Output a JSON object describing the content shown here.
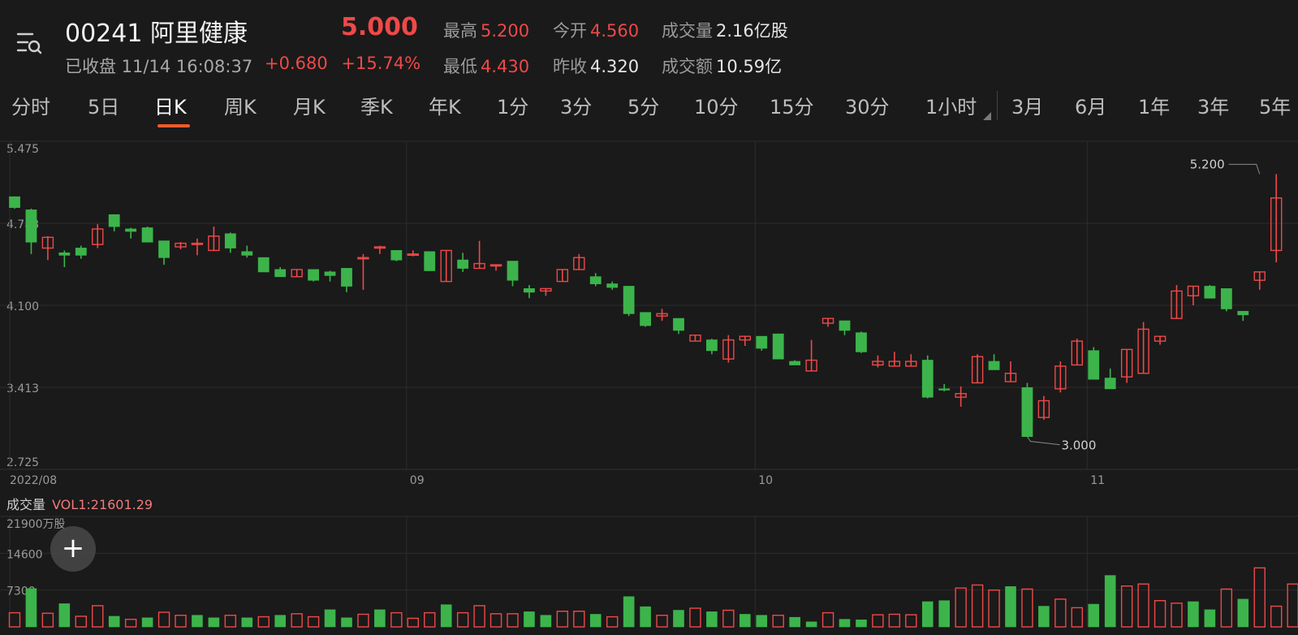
{
  "header": {
    "menu_icon": "menu-search-icon",
    "title": "00241 阿里健康",
    "price": "5.000",
    "status": "已收盘 11/14 16:08:37",
    "change_abs": "+0.680",
    "change_pct": "+15.74%",
    "stats": {
      "high_label": "最高",
      "high": "5.200",
      "open_label": "今开",
      "open": "4.560",
      "volume_label": "成交量",
      "volume": "2.16亿股",
      "low_label": "最低",
      "low": "4.430",
      "prev_close_label": "昨收",
      "prev_close": "4.320",
      "turnover_label": "成交额",
      "turnover": "10.59亿"
    },
    "colors": {
      "up": "#f04848",
      "down": "#3cb44b",
      "accent": "#f05a28"
    }
  },
  "tabs": [
    "分时",
    "5日",
    "日K",
    "周K",
    "月K",
    "季K",
    "年K",
    "1分",
    "3分",
    "5分",
    "10分",
    "15分",
    "30分",
    "1小时",
    "3月",
    "6月",
    "1年",
    "3年",
    "5年"
  ],
  "active_tab": "日K",
  "volume_panel": {
    "title": "成交量",
    "indicator": "VOL1:21601.29",
    "unit_label": "21900万股",
    "ticks": [
      "14600",
      "7300"
    ]
  },
  "plus_icon": "plus-icon",
  "chart_data": [
    {
      "type": "candlestick",
      "title": "",
      "y_ticks": [
        "5.475",
        "4.788",
        "4.100",
        "3.413",
        "2.725"
      ],
      "ylim": [
        2.725,
        5.475
      ],
      "x_labels": [
        "2022/08",
        "09",
        "10",
        "11"
      ],
      "annotations": [
        {
          "text": "5.200",
          "x_index": 75,
          "value": 5.2
        },
        {
          "text": "3.000",
          "x_index": 61,
          "value": 3.0
        }
      ],
      "candles": [
        [
          5.01,
          5.01,
          4.91,
          4.92
        ],
        [
          4.9,
          4.91,
          4.53,
          4.63
        ],
        [
          4.58,
          4.68,
          4.48,
          4.67
        ],
        [
          4.54,
          4.56,
          4.42,
          4.52
        ],
        [
          4.58,
          4.6,
          4.49,
          4.52
        ],
        [
          4.61,
          4.78,
          4.58,
          4.74
        ],
        [
          4.86,
          4.86,
          4.72,
          4.76
        ],
        [
          4.74,
          4.75,
          4.66,
          4.72
        ],
        [
          4.75,
          4.76,
          4.63,
          4.63
        ],
        [
          4.64,
          4.64,
          4.44,
          4.5
        ],
        [
          4.59,
          4.63,
          4.57,
          4.62
        ],
        [
          4.61,
          4.66,
          4.52,
          4.62
        ],
        [
          4.56,
          4.76,
          4.56,
          4.68
        ],
        [
          4.7,
          4.71,
          4.54,
          4.58
        ],
        [
          4.55,
          4.6,
          4.5,
          4.52
        ],
        [
          4.5,
          4.5,
          4.38,
          4.38
        ],
        [
          4.4,
          4.42,
          4.34,
          4.34
        ],
        [
          4.34,
          4.4,
          4.34,
          4.4
        ],
        [
          4.4,
          4.4,
          4.3,
          4.31
        ],
        [
          4.38,
          4.39,
          4.3,
          4.35
        ],
        [
          4.41,
          4.41,
          4.21,
          4.26
        ],
        [
          4.5,
          4.53,
          4.23,
          4.5
        ],
        [
          4.59,
          4.6,
          4.53,
          4.59
        ],
        [
          4.56,
          4.56,
          4.47,
          4.48
        ],
        [
          4.53,
          4.56,
          4.51,
          4.53
        ],
        [
          4.55,
          4.55,
          4.39,
          4.39
        ],
        [
          4.3,
          4.56,
          4.3,
          4.56
        ],
        [
          4.48,
          4.54,
          4.38,
          4.41
        ],
        [
          4.41,
          4.64,
          4.41,
          4.45
        ],
        [
          4.44,
          4.44,
          4.39,
          4.44
        ],
        [
          4.47,
          4.47,
          4.26,
          4.31
        ],
        [
          4.24,
          4.27,
          4.16,
          4.21
        ],
        [
          4.22,
          4.24,
          4.18,
          4.24
        ],
        [
          4.3,
          4.4,
          4.3,
          4.4
        ],
        [
          4.4,
          4.53,
          4.4,
          4.5
        ],
        [
          4.34,
          4.37,
          4.26,
          4.28
        ],
        [
          4.28,
          4.3,
          4.23,
          4.25
        ],
        [
          4.26,
          4.26,
          4.01,
          4.03
        ],
        [
          4.04,
          4.04,
          3.92,
          3.93
        ],
        [
          4.01,
          4.07,
          3.97,
          4.03
        ],
        [
          3.99,
          3.99,
          3.86,
          3.89
        ],
        [
          3.8,
          3.85,
          3.8,
          3.85
        ],
        [
          3.81,
          3.82,
          3.69,
          3.72
        ],
        [
          3.65,
          3.85,
          3.62,
          3.81
        ],
        [
          3.81,
          3.84,
          3.76,
          3.84
        ],
        [
          3.84,
          3.84,
          3.72,
          3.74
        ],
        [
          3.86,
          3.86,
          3.65,
          3.65
        ],
        [
          3.63,
          3.64,
          3.6,
          3.6
        ],
        [
          3.55,
          3.81,
          3.55,
          3.64
        ],
        [
          3.95,
          3.99,
          3.92,
          3.99
        ],
        [
          3.97,
          3.97,
          3.85,
          3.89
        ],
        [
          3.87,
          3.88,
          3.7,
          3.71
        ],
        [
          3.6,
          3.68,
          3.58,
          3.63
        ],
        [
          3.59,
          3.71,
          3.59,
          3.63
        ],
        [
          3.59,
          3.69,
          3.59,
          3.63
        ],
        [
          3.64,
          3.68,
          3.32,
          3.33
        ],
        [
          3.4,
          3.44,
          3.38,
          3.39
        ],
        [
          3.33,
          3.42,
          3.25,
          3.36
        ],
        [
          3.45,
          3.69,
          3.45,
          3.67
        ],
        [
          3.63,
          3.69,
          3.57,
          3.56
        ],
        [
          3.46,
          3.63,
          3.46,
          3.53
        ],
        [
          3.41,
          3.45,
          3.0,
          3.0
        ],
        [
          3.16,
          3.34,
          3.14,
          3.3
        ],
        [
          3.4,
          3.63,
          3.37,
          3.59
        ],
        [
          3.6,
          3.82,
          3.6,
          3.8
        ],
        [
          3.72,
          3.75,
          3.48,
          3.48
        ],
        [
          3.49,
          3.57,
          3.4,
          3.4
        ],
        [
          3.5,
          3.73,
          3.45,
          3.73
        ],
        [
          3.53,
          3.96,
          3.53,
          3.9
        ],
        [
          3.8,
          3.84,
          3.77,
          3.84
        ],
        [
          3.99,
          4.27,
          3.99,
          4.22
        ],
        [
          4.18,
          4.26,
          4.1,
          4.26
        ],
        [
          4.26,
          4.27,
          4.16,
          4.16
        ],
        [
          4.24,
          4.24,
          4.05,
          4.07
        ],
        [
          4.05,
          4.05,
          3.97,
          4.02
        ],
        [
          4.31,
          4.38,
          4.23,
          4.38
        ],
        [
          4.56,
          5.2,
          4.46,
          5.0
        ]
      ]
    },
    {
      "type": "bar",
      "title": "成交量",
      "ylim": [
        0,
        21900
      ],
      "unit": "万股",
      "values": [
        2800,
        7600,
        2700,
        4600,
        2100,
        4200,
        2100,
        1500,
        1800,
        2900,
        2300,
        2300,
        1800,
        2300,
        1800,
        2000,
        2300,
        2600,
        2000,
        3400,
        1800,
        2500,
        3400,
        2800,
        1700,
        2800,
        4400,
        2800,
        4200,
        2600,
        2600,
        3000,
        2300,
        3100,
        3100,
        2500,
        2000,
        6000,
        4000,
        2300,
        3300,
        3700,
        3000,
        3300,
        2500,
        2300,
        2300,
        1900,
        1000,
        2800,
        1500,
        1400,
        2400,
        2500,
        2400,
        5000,
        5200,
        7700,
        8300,
        7300,
        8000,
        7500,
        4100,
        5500,
        3800,
        4500,
        10200,
        8100,
        8500,
        5200,
        4700,
        5000,
        3400,
        7500,
        5500,
        11700,
        4100,
        8500,
        6200,
        3900,
        5700,
        4900,
        11300,
        6200,
        5300,
        7100,
        3300,
        7200,
        21600
      ],
      "up_flags": [
        1,
        0,
        1,
        0,
        1,
        1,
        0,
        1,
        0,
        1,
        1,
        0,
        0,
        1,
        0,
        1,
        0,
        1,
        1,
        0,
        0,
        1,
        0,
        1,
        1,
        1,
        0,
        1,
        1,
        1,
        1,
        0,
        0,
        1,
        1,
        0,
        1,
        0,
        0,
        1,
        0,
        1,
        0,
        1,
        0,
        0,
        1,
        0,
        0,
        1,
        0,
        0,
        1,
        1,
        1,
        0,
        0,
        1,
        1,
        1,
        0,
        1,
        0,
        1,
        1,
        0,
        0,
        1,
        1,
        1,
        1,
        0,
        0,
        1,
        0,
        1,
        1,
        1,
        1,
        0,
        1,
        0,
        1,
        1,
        0,
        0,
        0,
        1,
        1
      ]
    }
  ]
}
